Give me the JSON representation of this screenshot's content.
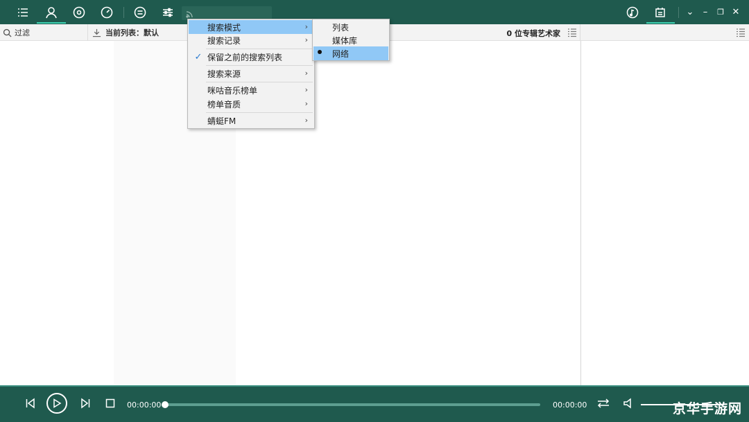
{
  "titlebar": {
    "icons": [
      "list-icon",
      "person-icon",
      "disc-icon",
      "gauge-icon",
      "equalizer-circle-icon",
      "sliders-icon",
      "rss-icon"
    ],
    "right_icons": [
      "music-note-circle-icon",
      "calendar-icon"
    ],
    "window_controls": {
      "collapse": "⌄",
      "minimize": "–",
      "restore": "❐",
      "close": "✕"
    }
  },
  "toolbar": {
    "filter_label": "过滤",
    "current_list_label": "当前列表：默认",
    "album_artist_count": "0 位专辑艺术家"
  },
  "menu": {
    "items": [
      {
        "label": "搜索模式",
        "has_submenu": true,
        "highlighted": true
      },
      {
        "label": "搜索记录",
        "has_submenu": true
      },
      {
        "label": "保留之前的搜索列表",
        "checked": true
      },
      {
        "label": "搜索来源",
        "has_submenu": true
      },
      {
        "label": "咪咕音乐榜单",
        "has_submenu": true
      },
      {
        "label": "榜单音质",
        "has_submenu": true
      },
      {
        "label": "蜻蜓FM",
        "has_submenu": true
      }
    ],
    "submenu": [
      {
        "label": "列表"
      },
      {
        "label": "媒体库"
      },
      {
        "label": "网络",
        "selected": true,
        "highlighted": true
      }
    ]
  },
  "player": {
    "elapsed": "00:00:00",
    "total": "00:00:00",
    "progress": 0
  },
  "watermark": "京华手游网",
  "colors": {
    "accent": "#1f5a4e",
    "highlight": "#90c8f6",
    "underline": "#3dd0b0"
  }
}
